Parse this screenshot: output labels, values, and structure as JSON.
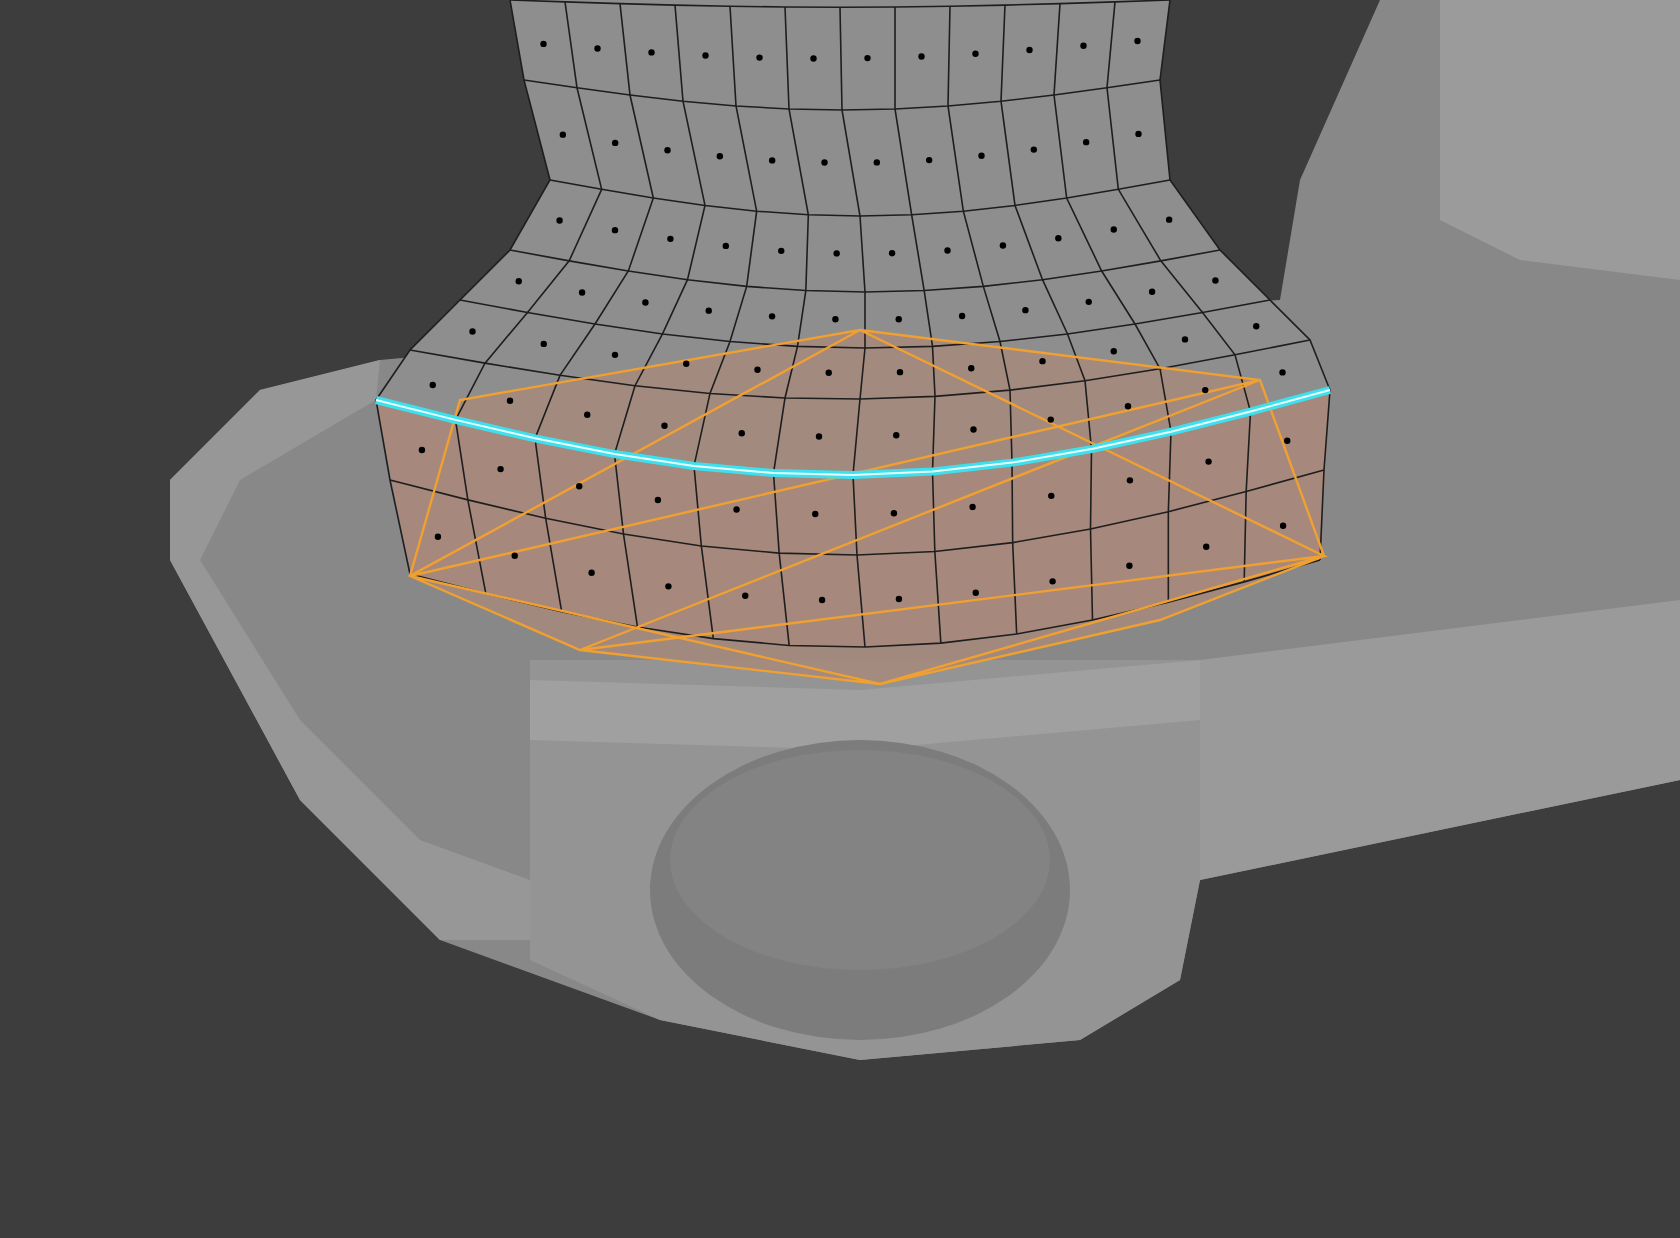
{
  "viewport": {
    "kind": "mesh-edit"
  }
}
